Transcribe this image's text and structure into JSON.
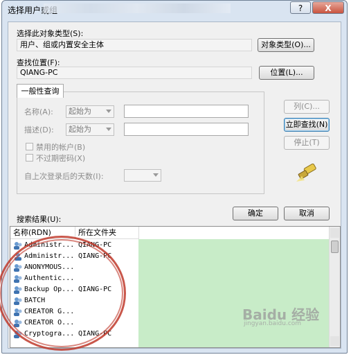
{
  "window": {
    "title": "选择用户或组",
    "help_label": "?",
    "close_label": "X"
  },
  "object_type": {
    "label": "选择此对象类型(S):",
    "value": "用户、组或内置安全主体",
    "button": "对象类型(O)..."
  },
  "location": {
    "label": "查找位置(F):",
    "value": "QIANG-PC",
    "button": "位置(L)..."
  },
  "common_query": {
    "tab": "一般性查询",
    "name_label": "名称(A):",
    "name_mode": "起始为",
    "desc_label": "描述(D):",
    "desc_mode": "起始为",
    "disabled_accounts": "禁用的帐户(B)",
    "non_expiring_pw": "不过期密码(X)",
    "days_label": "自上次登录后的天数(I):"
  },
  "buttons": {
    "columns": "列(C)...",
    "find_now": "立即查找(N)",
    "stop": "停止(T)",
    "ok": "确定",
    "cancel": "取消"
  },
  "results": {
    "label": "搜索结果(U):",
    "columns": [
      "名称(RDN)",
      "所在文件夹"
    ],
    "rows": [
      {
        "name": "Administr...",
        "folder": "QIANG-PC"
      },
      {
        "name": "Administr...",
        "folder": "QIANG-PC"
      },
      {
        "name": "ANONYMOUS...",
        "folder": ""
      },
      {
        "name": "Authentic...",
        "folder": ""
      },
      {
        "name": "Backup Op...",
        "folder": "QIANG-PC"
      },
      {
        "name": "BATCH",
        "folder": ""
      },
      {
        "name": "CREATOR G...",
        "folder": ""
      },
      {
        "name": "CREATOR O...",
        "folder": ""
      },
      {
        "name": "Cryptogra...",
        "folder": "QIANG-PC"
      }
    ]
  },
  "watermark": {
    "text": "Baidu 经验",
    "sub": "jingyan.baidu.com"
  },
  "colors": {
    "highlight_green": "#c8ecc8",
    "annotation_red": "#c0392b",
    "window_blue": "#d9e4f1"
  }
}
